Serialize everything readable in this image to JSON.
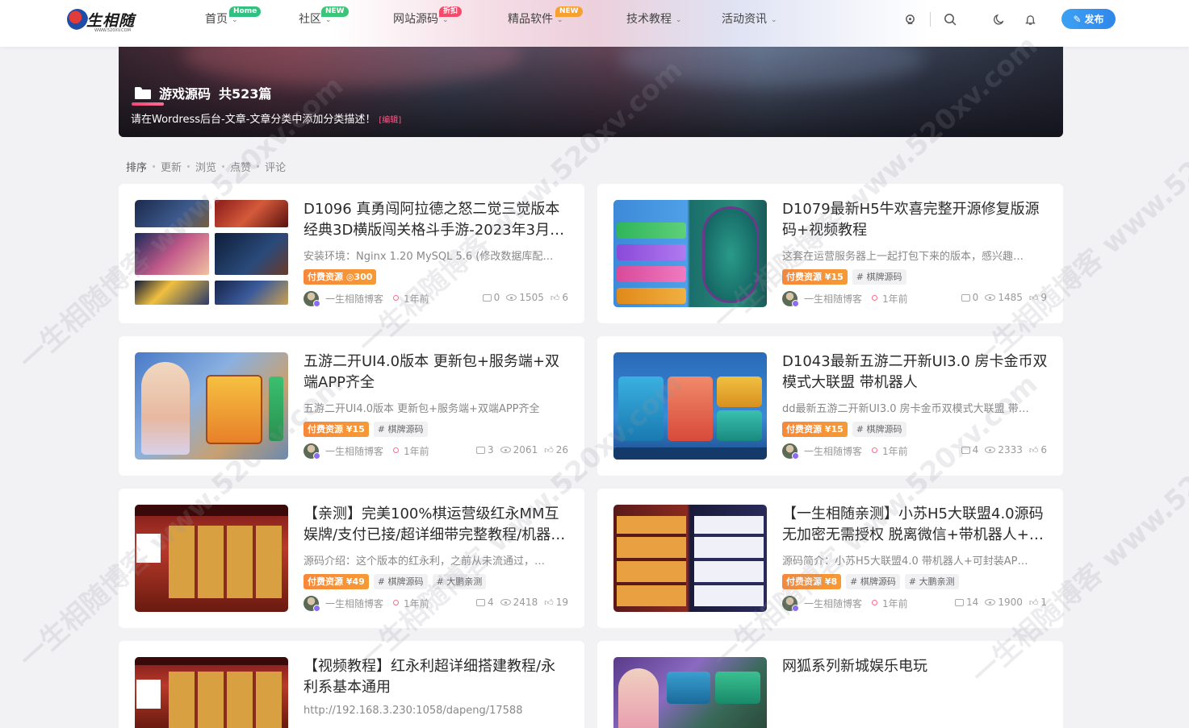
{
  "header": {
    "logo_text": "生相随",
    "logo_sub": "WWW.520XV.COM",
    "nav": [
      {
        "label": "首页",
        "badge": "Home",
        "badge_color": "#31c07f"
      },
      {
        "label": "社区",
        "badge": "NEW",
        "badge_color": "#3cc478"
      },
      {
        "label": "网站源码",
        "badge": "折扣",
        "badge_color": "#f54a6a"
      },
      {
        "label": "精品软件",
        "badge": "NEW",
        "badge_color": "#f5a030"
      },
      {
        "label": "技术教程",
        "badge": "",
        "badge_color": ""
      },
      {
        "label": "活动资讯",
        "badge": "",
        "badge_color": ""
      }
    ],
    "publish_label": "发布"
  },
  "banner": {
    "category": "游戏源码",
    "count": "共523篇",
    "description": "请在Wordress后台-文章-文章分类中添加分类描述！",
    "edit_label": "[编辑]"
  },
  "sort": {
    "label": "排序",
    "options": [
      "更新",
      "浏览",
      "点赞",
      "评论"
    ]
  },
  "posts": [
    {
      "title": "D1096 真勇闯阿拉德之怒二觉三觉版本经典3D横版闯关格斗手游-2023年3月7…",
      "desc": "安装环境：Nginx 1.20 MySQL 5.6 (修改数据库配…",
      "paid": "付费资源 ◎300",
      "tags": [],
      "author": "一生相随博客",
      "time": "1年前",
      "comments": "0",
      "views": "1505",
      "likes": "6"
    },
    {
      "title": "D1079最新H5牛欢喜完整开源修复版源码+视频教程",
      "desc": "这套在运营服务器上一起打包下来的版本，感兴趣…",
      "paid": "付费资源 ¥15",
      "tags": [
        "# 棋牌源码"
      ],
      "author": "一生相随博客",
      "time": "1年前",
      "comments": "0",
      "views": "1485",
      "likes": "9"
    },
    {
      "title": "五游二开UI4.0版本 更新包+服务端+双端APP齐全",
      "desc": "五游二开UI4.0版本 更新包+服务端+双端APP齐全",
      "paid": "付费资源 ¥15",
      "tags": [
        "# 棋牌源码"
      ],
      "author": "一生相随博客",
      "time": "1年前",
      "comments": "3",
      "views": "2061",
      "likes": "26"
    },
    {
      "title": "D1043最新五游二开新UI3.0 房卡金币双模式大联盟 带机器人",
      "desc": "dd最新五游二开新UI3.0 房卡金币双模式大联盟 带…",
      "paid": "付费资源 ¥15",
      "tags": [
        "# 棋牌源码"
      ],
      "author": "一生相随博客",
      "time": "1年前",
      "comments": "4",
      "views": "2333",
      "likes": "6"
    },
    {
      "title": "【亲测】完美100%棋运营级红永MM互娱牌/支付已接/超详细带完整教程/机器…",
      "desc": "源码介绍：这个版本的红永利，之前从未流通过，…",
      "paid": "付费资源 ¥49",
      "tags": [
        "# 棋牌源码",
        "# 大鹏亲测"
      ],
      "author": "一生相随博客",
      "time": "1年前",
      "comments": "4",
      "views": "2418",
      "likes": "19"
    },
    {
      "title": "【一生相随亲测】小苏H5大联盟4.0源码无加密无需授权 脱离微信+带机器人+…",
      "desc": "源码简介：小苏H5大联盟4.0 带机器人+可封装AP…",
      "paid": "付费资源 ¥8",
      "tags": [
        "# 棋牌源码",
        "# 大鹏亲测"
      ],
      "author": "一生相随博客",
      "time": "1年前",
      "comments": "14",
      "views": "1900",
      "likes": "1"
    },
    {
      "title": "【视频教程】红永利超详细搭建教程/永利系基本通用",
      "desc": "http://192.168.3.230:1058/dapeng/17588",
      "paid": "",
      "tags": [],
      "author": "",
      "time": "",
      "comments": "",
      "views": "",
      "likes": ""
    },
    {
      "title": "网狐系列新城娱乐电玩",
      "desc": "",
      "paid": "",
      "tags": [],
      "author": "",
      "time": "",
      "comments": "",
      "views": "",
      "likes": ""
    }
  ],
  "watermark": "一生相随博客 www.520xv.com",
  "colors": {
    "accent": "#2f87ea",
    "paid_tag": "#f7883a",
    "time_dot": "#ff6a8a",
    "banner_underline": "#f0457a"
  },
  "icons": [
    "search-icon",
    "moon-icon",
    "bell-icon",
    "pen-icon",
    "folder-icon",
    "comment-icon",
    "eye-icon",
    "like-icon"
  ]
}
